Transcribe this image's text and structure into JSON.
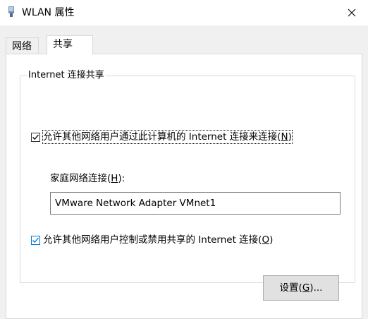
{
  "window": {
    "title": "WLAN 属性",
    "icon": "wifi-adapter-icon",
    "close_icon": "close-icon"
  },
  "tabs": [
    {
      "label": "网络",
      "selected": false
    },
    {
      "label": "共享",
      "selected": true
    }
  ],
  "sharing": {
    "group_title": "Internet 连接共享",
    "allow_share": {
      "checked": true,
      "label_prefix": "允许其他网络用户通过此计算机的 Internet 连接来连接(",
      "access_key": "N",
      "label_suffix": ")"
    },
    "home_network": {
      "label_prefix": "家庭网络连接(",
      "access_key": "H",
      "label_suffix": "):",
      "value": "VMware Network Adapter VMnet1"
    },
    "allow_control": {
      "checked": true,
      "label_prefix": "允许其他网络用户控制或禁用共享的 Internet 连接(",
      "access_key": "O",
      "label_suffix": ")"
    },
    "settings_button": {
      "label_prefix": "设置(",
      "access_key": "G",
      "label_suffix": ")..."
    }
  }
}
